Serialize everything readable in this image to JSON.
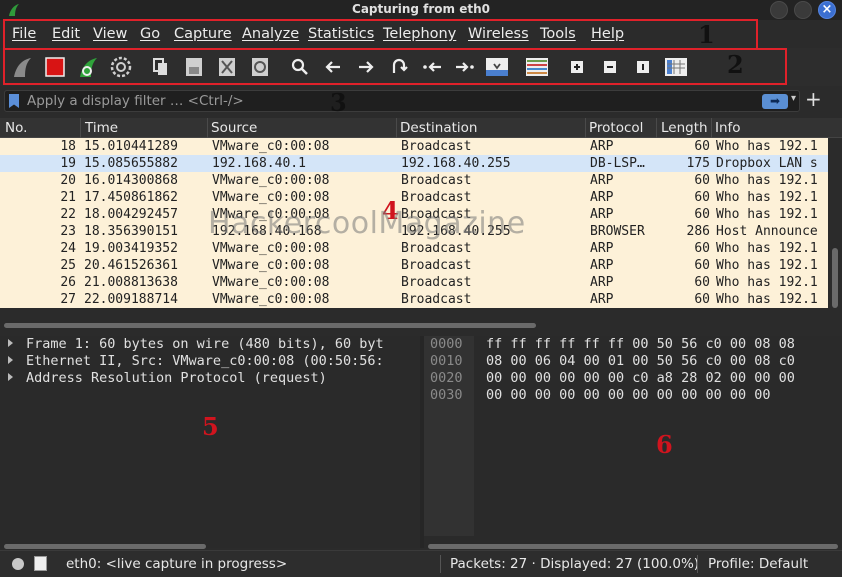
{
  "window": {
    "title": "Capturing from eth0"
  },
  "menu": [
    "File",
    "Edit",
    "View",
    "Go",
    "Capture",
    "Analyze",
    "Statistics",
    "Telephony",
    "Wireless",
    "Tools",
    "Help"
  ],
  "annotations": [
    "1",
    "2",
    "3",
    "4",
    "5",
    "6"
  ],
  "watermark": "HackercoolMagazine",
  "filter": {
    "placeholder": "Apply a display filter … <Ctrl-/>"
  },
  "packet_list": {
    "columns": [
      "No.",
      "Time",
      "Source",
      "Destination",
      "Protocol",
      "Length",
      "Info"
    ],
    "rows": [
      {
        "no": "18",
        "time": "15.010441289",
        "src": "VMware_c0:00:08",
        "dst": "Broadcast",
        "proto": "ARP",
        "len": "60",
        "info": "Who has 192.1",
        "highlight": false
      },
      {
        "no": "19",
        "time": "15.085655882",
        "src": "192.168.40.1",
        "dst": "192.168.40.255",
        "proto": "DB-LSP…",
        "len": "175",
        "info": "Dropbox LAN s",
        "highlight": true
      },
      {
        "no": "20",
        "time": "16.014300868",
        "src": "VMware_c0:00:08",
        "dst": "Broadcast",
        "proto": "ARP",
        "len": "60",
        "info": "Who has 192.1",
        "highlight": false
      },
      {
        "no": "21",
        "time": "17.450861862",
        "src": "VMware_c0:00:08",
        "dst": "Broadcast",
        "proto": "ARP",
        "len": "60",
        "info": "Who has 192.1",
        "highlight": false
      },
      {
        "no": "22",
        "time": "18.004292457",
        "src": "VMware_c0:00:08",
        "dst": "Broadcast",
        "proto": "ARP",
        "len": "60",
        "info": "Who has 192.1",
        "highlight": false
      },
      {
        "no": "23",
        "time": "18.356390151",
        "src": "192.168.40.168",
        "dst": "192.168.40.255",
        "proto": "BROWSER",
        "len": "286",
        "info": "Host Announce",
        "highlight": false
      },
      {
        "no": "24",
        "time": "19.003419352",
        "src": "VMware_c0:00:08",
        "dst": "Broadcast",
        "proto": "ARP",
        "len": "60",
        "info": "Who has 192.1",
        "highlight": false
      },
      {
        "no": "25",
        "time": "20.461526361",
        "src": "VMware_c0:00:08",
        "dst": "Broadcast",
        "proto": "ARP",
        "len": "60",
        "info": "Who has 192.1",
        "highlight": false
      },
      {
        "no": "26",
        "time": "21.008813638",
        "src": "VMware_c0:00:08",
        "dst": "Broadcast",
        "proto": "ARP",
        "len": "60",
        "info": "Who has 192.1",
        "highlight": false
      },
      {
        "no": "27",
        "time": "22.009188714",
        "src": "VMware_c0:00:08",
        "dst": "Broadcast",
        "proto": "ARP",
        "len": "60",
        "info": "Who has 192.1",
        "highlight": false
      }
    ]
  },
  "details": [
    "Frame 1: 60 bytes on wire (480 bits), 60 byt",
    "Ethernet II, Src: VMware_c0:00:08 (00:50:56:",
    "Address Resolution Protocol (request)"
  ],
  "bytes": [
    {
      "offset": "0000",
      "hex": "ff ff ff ff ff ff 00 50  56 c0 00 08 08"
    },
    {
      "offset": "0010",
      "hex": "08 00 06 04 00 01 00 50  56 c0 00 08 c0"
    },
    {
      "offset": "0020",
      "hex": "00 00 00 00 00 00 c0 a8  28 02 00 00 00"
    },
    {
      "offset": "0030",
      "hex": "00 00 00 00 00 00 00 00  00 00 00 00"
    }
  ],
  "status": {
    "capture": "eth0: <live capture in progress>",
    "packets": "Packets: 27 · Displayed: 27 (100.0%)",
    "profile": "Profile: Default"
  },
  "colors": {
    "annotation": "#e0212a",
    "row_default": "#fdf1d8",
    "row_highlight": "#d4e5f8",
    "accent": "#3b6fd1"
  }
}
